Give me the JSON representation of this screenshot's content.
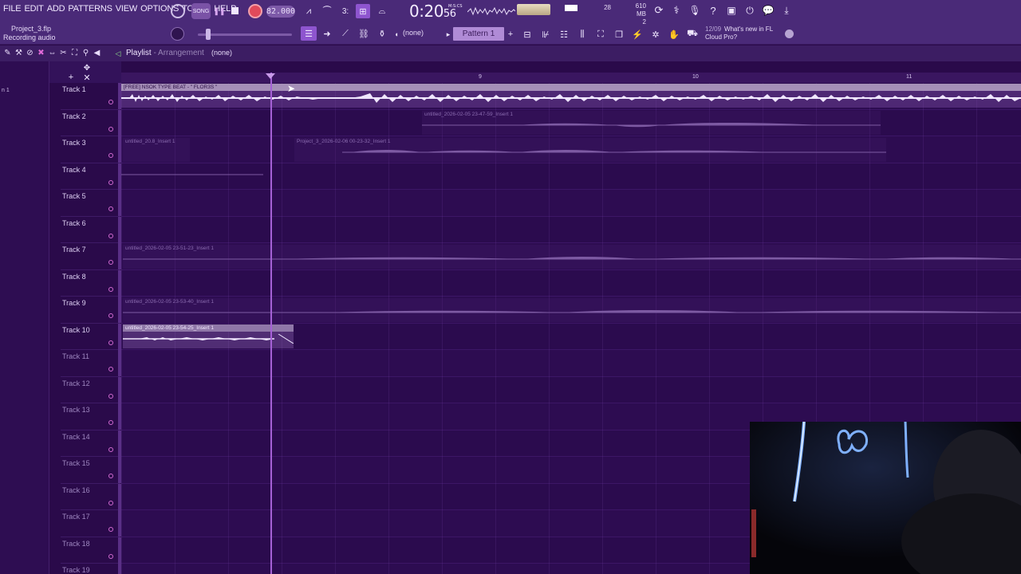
{
  "menu": [
    "FILE",
    "EDIT",
    "ADD",
    "PATTERNS",
    "VIEW",
    "OPTIONS",
    "TOOLS",
    "HELP"
  ],
  "project": {
    "name": "Project_3.flp",
    "status": "Recording audio"
  },
  "transport": {
    "tempo": "82.000",
    "time_main": "0:20",
    "time_small": "56",
    "time_unit": "M:S:CS"
  },
  "monitor": {
    "cpu_value": "28",
    "memory": "610 MB",
    "voices": "2"
  },
  "toolbar2": {
    "none_label": "(none)",
    "pattern_label": "Pattern 1"
  },
  "news": {
    "date": "12/09",
    "text_line1": "What's new in FL",
    "text_line2": "Cloud Pro?"
  },
  "playlist": {
    "title": "Playlist",
    "separator": " - ",
    "subtitle": "Arrangement",
    "none_label": "(none)"
  },
  "left_strip": {
    "picker": "n 1"
  },
  "ruler": [
    "9",
    "10",
    "11"
  ],
  "tracks": [
    "Track 1",
    "Track 2",
    "Track 3",
    "Track 4",
    "Track 5",
    "Track 6",
    "Track 7",
    "Track 8",
    "Track 9",
    "Track 10",
    "Track 11",
    "Track 12",
    "Track 13",
    "Track 14",
    "Track 15",
    "Track 16",
    "Track 17",
    "Track 18",
    "Track 19"
  ],
  "clips": {
    "t1": "[FREE] NSOK TYPE BEAT - \" FLOR3S \"",
    "t2": "untitled_2026-02-05 23-47-59_Insert 1",
    "t3a": "untitled_20.8_Insert 1",
    "t3b": "Project_3_2026-02-06 00-23-32_Insert 1",
    "t7": "untitled_2026-02-05 23-51-23_Insert 1",
    "t9": "untitled_2026-02-05 23-53-40_Insert 1",
    "t10": "untitled_2026-02-05 23-54-25_Insert 1"
  },
  "colors": {
    "bg": "#2a0a4a",
    "toolbar": "#4a2a78",
    "accent": "#a561d6",
    "clip_header": "#a58fb8"
  }
}
